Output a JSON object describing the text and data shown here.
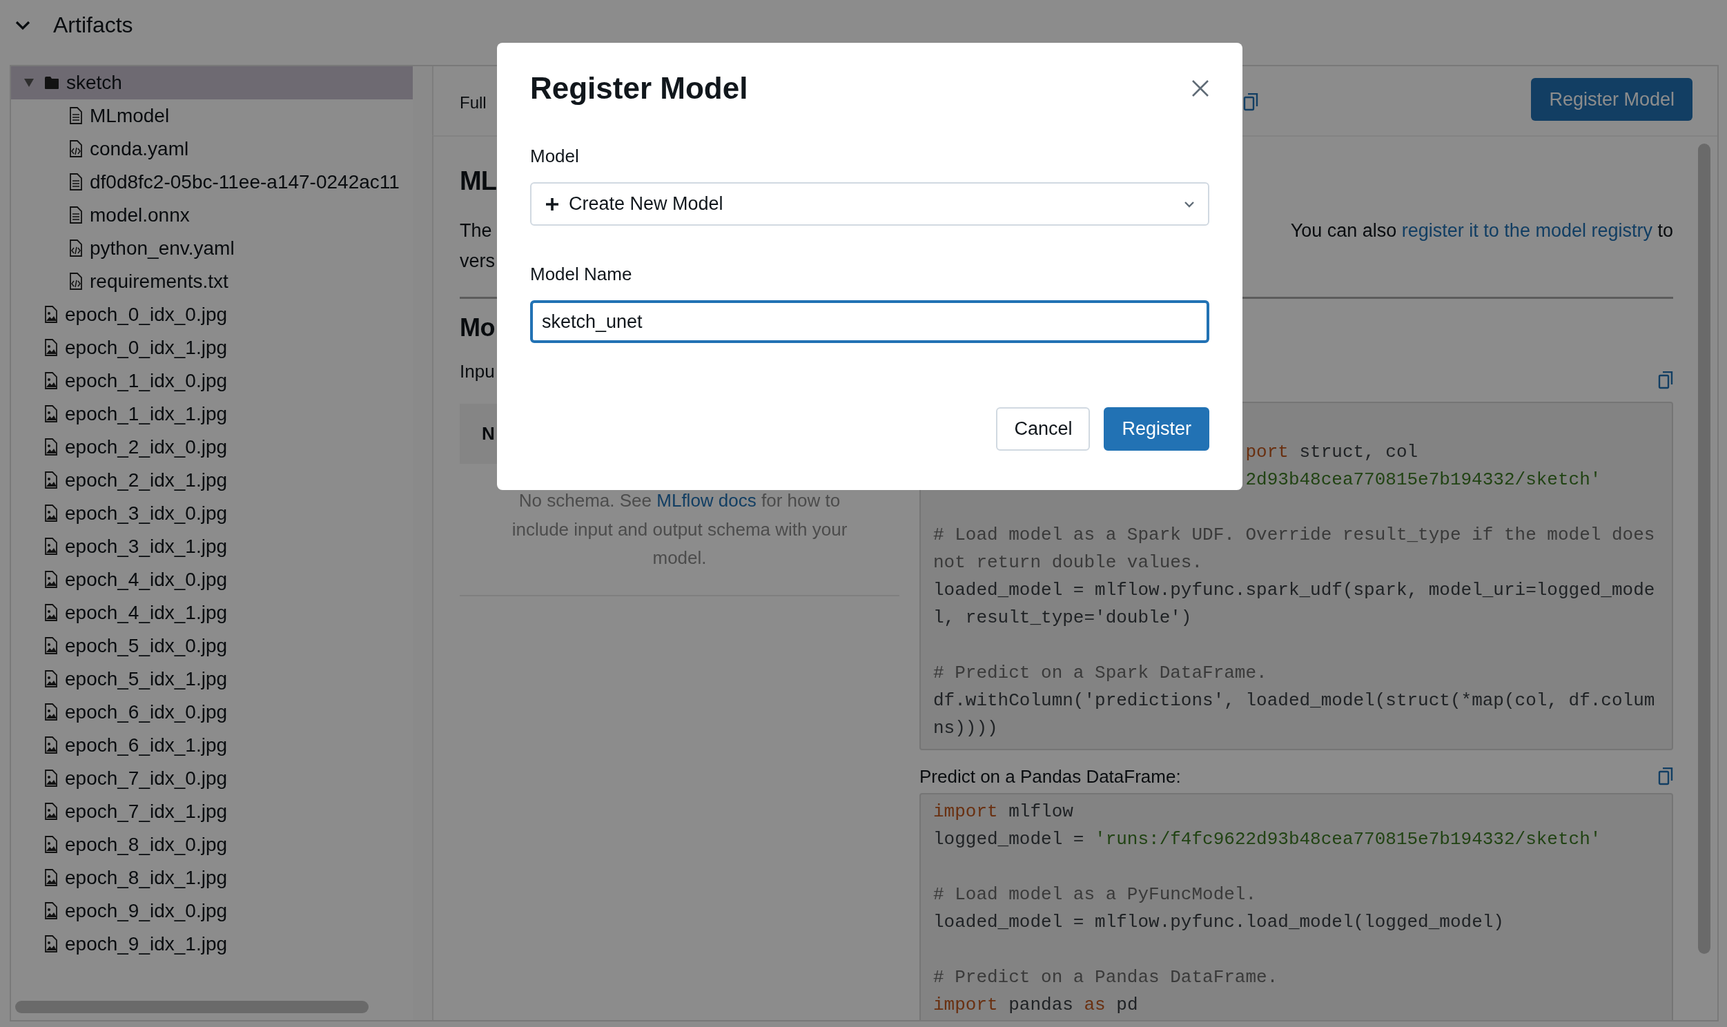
{
  "section": {
    "title": "Artifacts",
    "expanded": true
  },
  "file_tree": [
    {
      "name": "sketch",
      "kind": "folder",
      "expanded": true,
      "selected": true,
      "children": [
        {
          "name": "MLmodel",
          "kind": "text",
          "selected": false
        },
        {
          "name": "conda.yaml",
          "kind": "code",
          "selected": false
        },
        {
          "name": "df0d8fc2-05bc-11ee-a147-0242ac11",
          "kind": "text",
          "selected": false
        },
        {
          "name": "model.onnx",
          "kind": "text",
          "selected": false
        },
        {
          "name": "python_env.yaml",
          "kind": "code",
          "selected": false
        },
        {
          "name": "requirements.txt",
          "kind": "code",
          "selected": false
        }
      ]
    },
    {
      "name": "epoch_0_idx_0.jpg",
      "kind": "image",
      "selected": false
    },
    {
      "name": "epoch_0_idx_1.jpg",
      "kind": "image",
      "selected": false
    },
    {
      "name": "epoch_1_idx_0.jpg",
      "kind": "image",
      "selected": false
    },
    {
      "name": "epoch_1_idx_1.jpg",
      "kind": "image",
      "selected": false
    },
    {
      "name": "epoch_2_idx_0.jpg",
      "kind": "image",
      "selected": false
    },
    {
      "name": "epoch_2_idx_1.jpg",
      "kind": "image",
      "selected": false
    },
    {
      "name": "epoch_3_idx_0.jpg",
      "kind": "image",
      "selected": false
    },
    {
      "name": "epoch_3_idx_1.jpg",
      "kind": "image",
      "selected": false
    },
    {
      "name": "epoch_4_idx_0.jpg",
      "kind": "image",
      "selected": false
    },
    {
      "name": "epoch_4_idx_1.jpg",
      "kind": "image",
      "selected": false
    },
    {
      "name": "epoch_5_idx_0.jpg",
      "kind": "image",
      "selected": false
    },
    {
      "name": "epoch_5_idx_1.jpg",
      "kind": "image",
      "selected": false
    },
    {
      "name": "epoch_6_idx_0.jpg",
      "kind": "image",
      "selected": false
    },
    {
      "name": "epoch_6_idx_1.jpg",
      "kind": "image",
      "selected": false
    },
    {
      "name": "epoch_7_idx_0.jpg",
      "kind": "image",
      "selected": false
    },
    {
      "name": "epoch_7_idx_1.jpg",
      "kind": "image",
      "selected": false
    },
    {
      "name": "epoch_8_idx_0.jpg",
      "kind": "image",
      "selected": false
    },
    {
      "name": "epoch_8_idx_1.jpg",
      "kind": "image",
      "selected": false
    },
    {
      "name": "epoch_9_idx_0.jpg",
      "kind": "image",
      "selected": false
    },
    {
      "name": "epoch_9_idx_1.jpg",
      "kind": "image",
      "selected": false
    }
  ],
  "detail": {
    "path_label": "Full",
    "register_button": "Register Model",
    "heading": "ML",
    "description": {
      "left_lines": [
        "The",
        "vers"
      ],
      "text_before": "You can also ",
      "link": "register it to the model registry",
      "text_after": " to"
    },
    "schema": {
      "heading": "Mo",
      "subheading": "Inpu",
      "table_header": "N",
      "empty_before": "No schema. See ",
      "empty_link": "MLflow docs",
      "empty_after": " for how to include input and output schema with your model."
    },
    "code_blocks": [
      {
        "lines": [
          {
            "kind": "partial",
            "tokens": [
              {
                "kind": "keyword",
                "text": "port"
              },
              {
                "kind": "plain",
                "text": " struct, col"
              }
            ]
          },
          {
            "kind": "partial",
            "tokens": [
              {
                "kind": "string",
                "text": "2d93b48cea770815e7b194332/sketch'"
              }
            ]
          },
          {
            "kind": "blank"
          },
          {
            "kind": "code",
            "tokens": [
              {
                "kind": "comment",
                "text": "# Load model as a Spark UDF. Override result_type if the model does"
              }
            ]
          },
          {
            "kind": "code",
            "tokens": [
              {
                "kind": "comment",
                "text": "not return double values."
              }
            ]
          },
          {
            "kind": "code",
            "tokens": [
              {
                "kind": "plain",
                "text": "loaded_model = mlflow.pyfunc.spark_udf(spark, model_uri=logged_mode"
              }
            ]
          },
          {
            "kind": "code",
            "tokens": [
              {
                "kind": "plain",
                "text": "l, result_type='double')"
              }
            ]
          },
          {
            "kind": "blank"
          },
          {
            "kind": "code",
            "tokens": [
              {
                "kind": "comment",
                "text": "# Predict on a Spark DataFrame."
              }
            ]
          },
          {
            "kind": "code",
            "tokens": [
              {
                "kind": "plain",
                "text": "df.withColumn('predictions', loaded_model(struct(*map(col, df.colum"
              }
            ]
          },
          {
            "kind": "code",
            "tokens": [
              {
                "kind": "plain",
                "text": "ns))))"
              }
            ]
          }
        ]
      },
      {
        "label": "Predict on a Pandas DataFrame:",
        "lines": [
          {
            "kind": "code",
            "tokens": [
              {
                "kind": "keyword",
                "text": "import"
              },
              {
                "kind": "plain",
                "text": " mlflow"
              }
            ]
          },
          {
            "kind": "code",
            "tokens": [
              {
                "kind": "plain",
                "text": "logged_model = "
              },
              {
                "kind": "string",
                "text": "'runs:/f4fc9622d93b48cea770815e7b194332/sketch'"
              }
            ]
          },
          {
            "kind": "blank"
          },
          {
            "kind": "code",
            "tokens": [
              {
                "kind": "comment",
                "text": "# Load model as a PyFuncModel."
              }
            ]
          },
          {
            "kind": "code",
            "tokens": [
              {
                "kind": "plain",
                "text": "loaded_model = mlflow.pyfunc.load_model(logged_model)"
              }
            ]
          },
          {
            "kind": "blank"
          },
          {
            "kind": "code",
            "tokens": [
              {
                "kind": "comment",
                "text": "# Predict on a Pandas DataFrame."
              }
            ]
          },
          {
            "kind": "code",
            "tokens": [
              {
                "kind": "keyword",
                "text": "import"
              },
              {
                "kind": "plain",
                "text": " pandas "
              },
              {
                "kind": "keyword",
                "text": "as"
              },
              {
                "kind": "plain",
                "text": " pd"
              }
            ]
          }
        ]
      }
    ]
  },
  "dialog": {
    "title": "Register Model",
    "model_label": "Model",
    "model_select": {
      "value": "Create New Model"
    },
    "name_label": "Model Name",
    "name_input": {
      "value": "sketch_unet",
      "focused": true
    },
    "buttons": [
      {
        "label": "Cancel",
        "kind": "secondary"
      },
      {
        "label": "Register",
        "kind": "primary"
      }
    ]
  }
}
